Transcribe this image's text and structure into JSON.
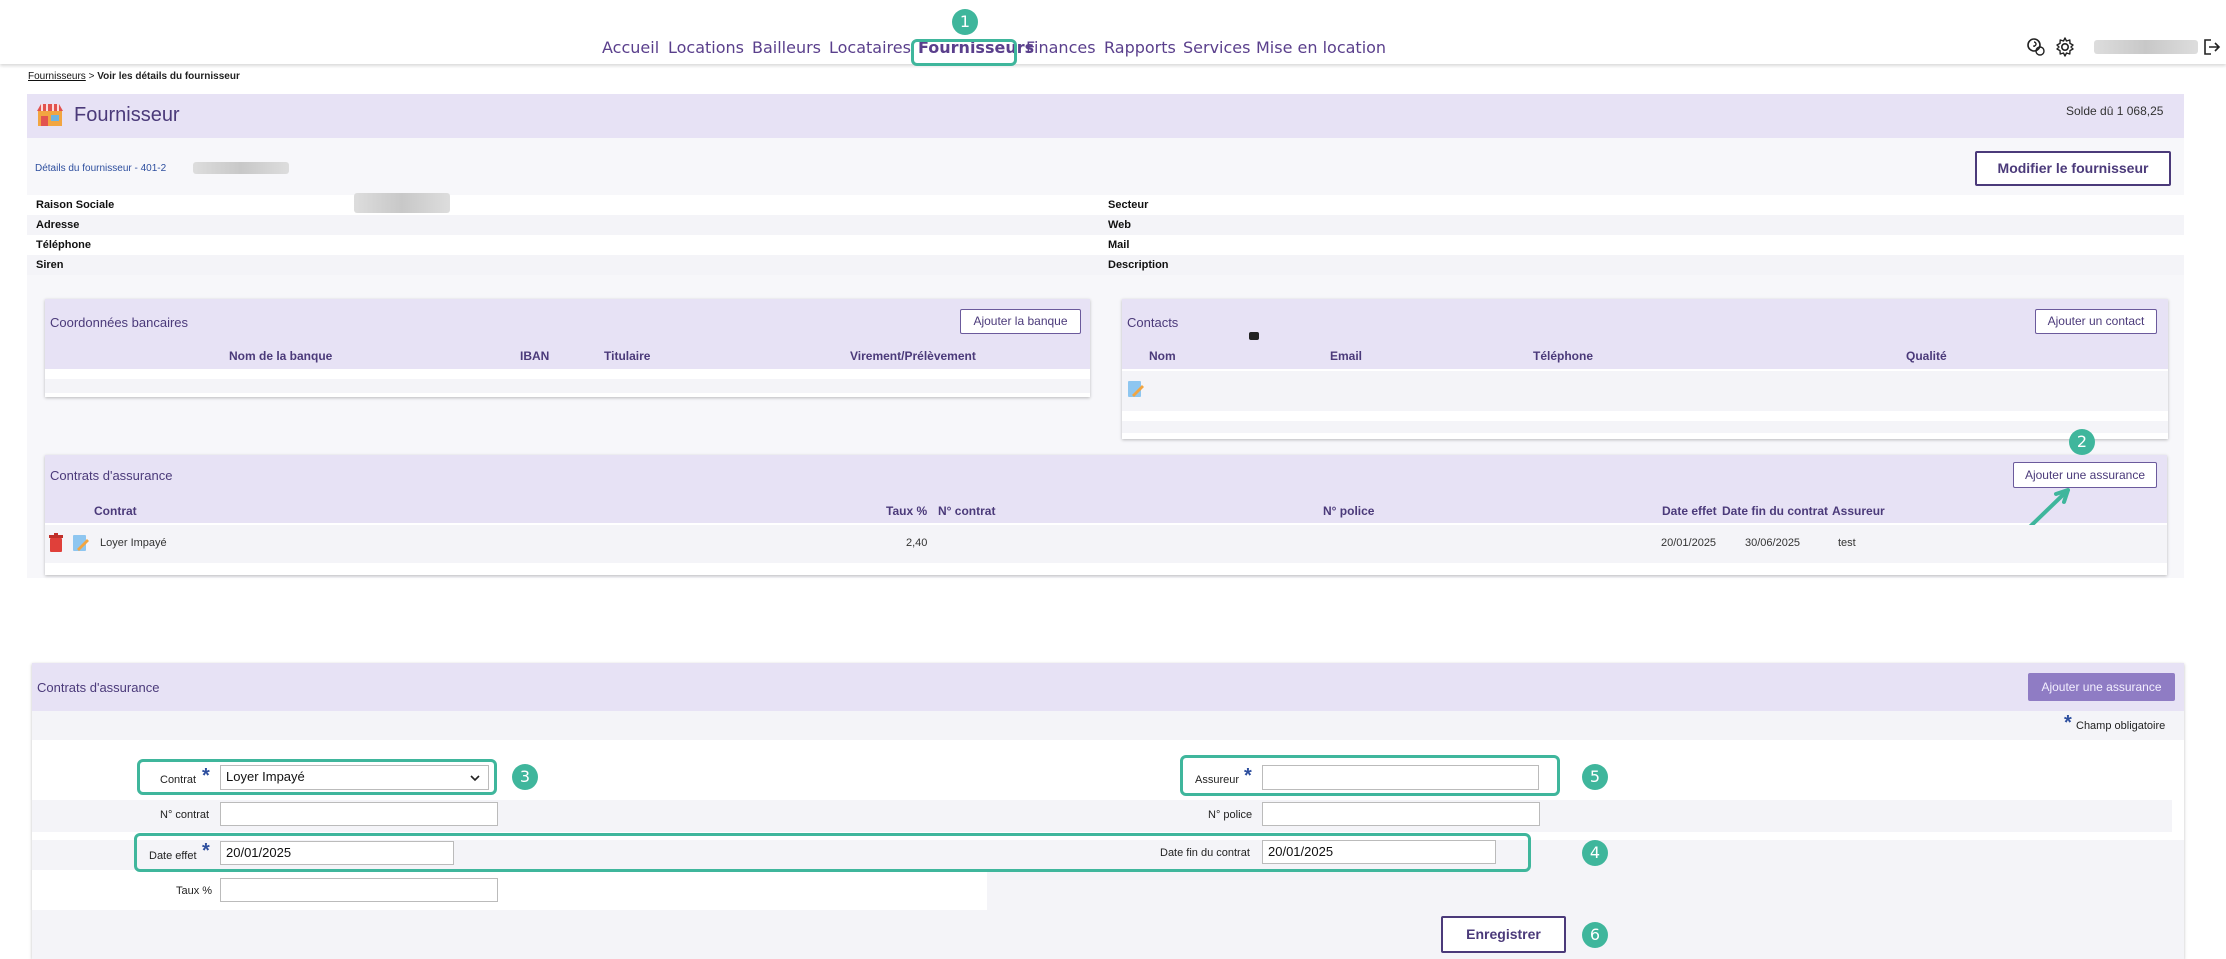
{
  "nav": {
    "items": [
      {
        "label": "Accueil"
      },
      {
        "label": "Locations"
      },
      {
        "label": "Bailleurs"
      },
      {
        "label": "Locataires"
      },
      {
        "label": "Fournisseurs"
      },
      {
        "label": "Finances"
      },
      {
        "label": "Rapports"
      },
      {
        "label": "Services"
      },
      {
        "label": "Mise en location"
      }
    ],
    "active": "Fournisseurs"
  },
  "steps": [
    "1",
    "2",
    "3",
    "4",
    "5",
    "6"
  ],
  "breadcrumb": {
    "link": "Fournisseurs",
    "separator": " > ",
    "current": "Voir les détails du fournisseur"
  },
  "header": {
    "title": "Fournisseur",
    "balance": "Solde dû 1 068,25"
  },
  "details": {
    "title": "Détails du fournisseur - 401-2",
    "edit_button": "Modifier le fournisseur",
    "left_labels": [
      "Raison Sociale",
      "Adresse",
      "Téléphone",
      "Siren"
    ],
    "right_labels": [
      "Secteur",
      "Web",
      "Mail",
      "Description"
    ]
  },
  "bank": {
    "title": "Coordonnées bancaires",
    "add_button": "Ajouter la banque",
    "columns": [
      "Nom de la banque",
      "IBAN",
      "Titulaire",
      "Virement/Prélèvement"
    ]
  },
  "contacts": {
    "title": "Contacts",
    "add_button": "Ajouter un contact",
    "columns": [
      "Nom",
      "Email",
      "Téléphone",
      "Qualité"
    ]
  },
  "insurance": {
    "title": "Contrats d'assurance",
    "add_button": "Ajouter une assurance",
    "columns": [
      "Contrat",
      "Taux %",
      "N° contrat",
      "N° police",
      "Date effet",
      "Date fin du contrat",
      "Assureur"
    ],
    "rows": [
      {
        "contrat": "Loyer Impayé",
        "taux": "2,40",
        "date_effet": "20/01/2025",
        "date_fin": "30/06/2025",
        "assureur": "test"
      }
    ]
  },
  "form": {
    "title": "Contrats d'assurance",
    "add_button": "Ajouter une assurance",
    "required_note": "Champ obligatoire",
    "contrat_label": "Contrat",
    "contrat_value": "Loyer Impayé",
    "assureur_label": "Assureur",
    "assureur_value": "",
    "n_contrat_label": "N° contrat",
    "n_contrat_value": "",
    "n_police_label": "N° police",
    "n_police_value": "",
    "date_effet_label": "Date effet",
    "date_effet_value": "20/01/2025",
    "date_fin_label": "Date fin du contrat",
    "date_fin_value": "20/01/2025",
    "taux_label": "Taux %",
    "taux_value": "",
    "save_button": "Enregistrer"
  },
  "colors": {
    "accent": "#3fb69c",
    "brand": "#4b3a7a",
    "band": "#e7e2f5"
  }
}
